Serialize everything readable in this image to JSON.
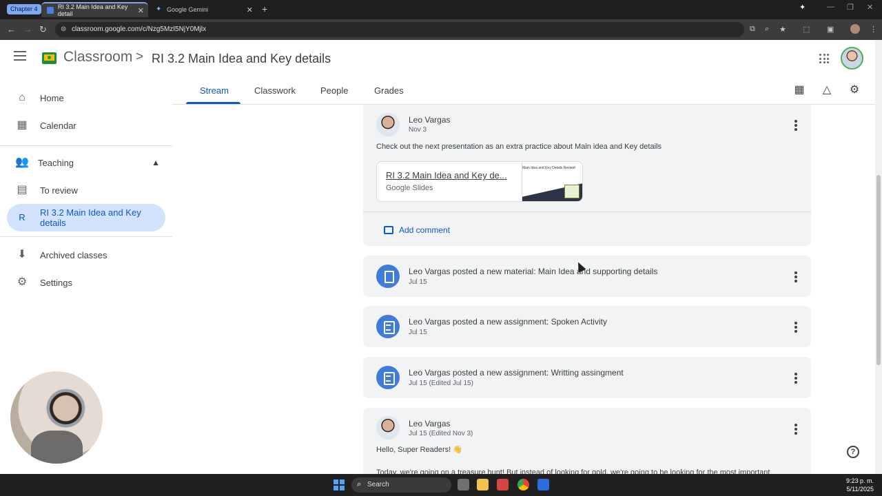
{
  "browser": {
    "tab_group": "Chapter 4",
    "tabs": [
      {
        "title": "RI 3.2 Main Idea and Key detail",
        "active": true
      },
      {
        "title": "Google Gemini",
        "active": false
      }
    ],
    "url": "classroom.google.com/c/Nzg5MzI5NjY0Mjlx"
  },
  "header": {
    "app_name": "Classroom",
    "separator": ">",
    "class_name": "RI 3.2 Main Idea and Key details"
  },
  "sidebar": {
    "items": [
      {
        "label": "Home",
        "icon": "home-icon"
      },
      {
        "label": "Calendar",
        "icon": "calendar-icon"
      },
      {
        "label": "Teaching",
        "icon": "teaching-icon"
      },
      {
        "label": "To review",
        "icon": "to-review-icon"
      },
      {
        "label": "RI 3.2 Main Idea and Key details",
        "badge": "R"
      },
      {
        "label": "Archived classes",
        "icon": "archive-icon"
      },
      {
        "label": "Settings",
        "icon": "gear-icon"
      }
    ]
  },
  "class_tabs": [
    "Stream",
    "Classwork",
    "People",
    "Grades"
  ],
  "stream": {
    "announcement": {
      "author": "Leo Vargas",
      "date": "Nov 3",
      "text": "Check out the next presentation as an extra practice about Main idea and Key details",
      "attachment": {
        "title": "RI 3.2 Main Idea and Key de...",
        "type": "Google Slides",
        "thumb_text": "Main Idea and Key Details Review!"
      },
      "comment_label": "Add comment"
    },
    "posts": [
      {
        "title": "Leo Vargas posted a new material: Main Idea and supporting details",
        "date": "Jul 15",
        "kind": "material"
      },
      {
        "title": "Leo Vargas posted a new assignment: Spoken Activity",
        "date": "Jul 15",
        "kind": "assignment"
      },
      {
        "title": "Leo Vargas posted a new assignment: Writting assingment",
        "date": "Jul 15 (Edited Jul 15)",
        "kind": "assignment"
      }
    ],
    "announcement2": {
      "author": "Leo Vargas",
      "date": "Jul 15 (Edited Nov 3)",
      "greeting": "Hello, Super Readers! 👋",
      "line2": "Today, we're going on a treasure hunt! But instead of looking for gold, we're going to be looking for the most important"
    }
  },
  "taskbar": {
    "search": "Search",
    "time": "9:23 p. m.",
    "date": "5/11/2025"
  },
  "colors": {
    "accent": "#0b57d0",
    "selected_bg": "#d3e3fd",
    "card_bg": "#f1f3f4",
    "post_icon": "#3f7bd9"
  }
}
